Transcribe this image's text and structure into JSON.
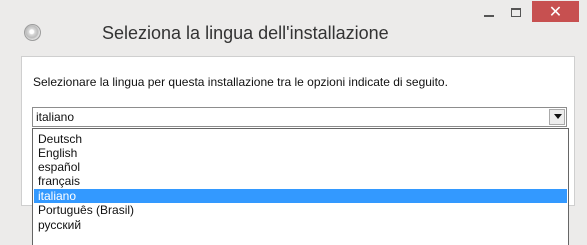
{
  "window": {
    "title": "Seleziona la lingua dell'installazione",
    "close_label": "✕"
  },
  "main": {
    "instruction": "Selezionare la lingua per questa installazione tra le opzioni indicate di seguito.",
    "selected_language": "italiano"
  },
  "dropdown": {
    "options": [
      "Deutsch",
      "English",
      "español",
      "français",
      "italiano",
      "Português (Brasil)",
      "русский"
    ]
  },
  "icons": {
    "app": "disc-icon",
    "minimize": "minimize-icon",
    "maximize": "maximize-icon",
    "close": "close-icon",
    "dropdown": "chevron-down-icon"
  },
  "colors": {
    "close_button": "#c75050",
    "selected_option": "#3399ff"
  }
}
